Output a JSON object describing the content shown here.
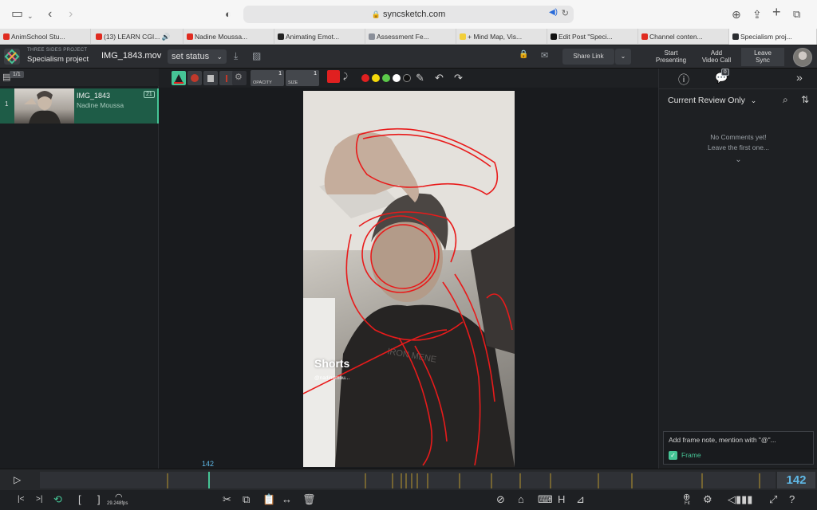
{
  "browser": {
    "url": "syncsketch.com",
    "tabs": [
      {
        "label": "AnimSchool Stu...",
        "favicon": "#e02b20"
      },
      {
        "label": "(13) LEARN CGI... 🔊",
        "favicon": "#e02b20"
      },
      {
        "label": "Nadine Moussa...",
        "favicon": "#e02b20"
      },
      {
        "label": "Animating Emot...",
        "favicon": "#222222"
      },
      {
        "label": "Assessment Fe...",
        "favicon": "#8a8f99"
      },
      {
        "label": "+ Mind Map, Vis...",
        "favicon": "#f2cf3a"
      },
      {
        "label": "Edit Post \"Speci...",
        "favicon": "#111111"
      },
      {
        "label": "Channel conten...",
        "favicon": "#e02b20"
      },
      {
        "label": "Specialism proj...",
        "favicon": "#2b2d31"
      }
    ]
  },
  "header": {
    "project_sub": "THREE SIDES PROJECT",
    "project_name": "Specialism project",
    "file_name": "IMG_1843.mov",
    "status_label": "set status",
    "share_link": "Share Link",
    "start_presenting": [
      "Start",
      "Presenting"
    ],
    "add_video_call": [
      "Add",
      "Video Call"
    ],
    "leave_sync": [
      "Leave",
      "Sync"
    ]
  },
  "left_panel": {
    "page_badge": "1/1",
    "asset": {
      "index": "1",
      "title": "IMG_1843",
      "author": "Nadine Moussa",
      "count": "21"
    }
  },
  "toolbar": {
    "opacity_label": "OPACITY",
    "opacity_value": "1",
    "size_label": "SIZE",
    "size_value": "1",
    "active_color": "#e02020",
    "palette": [
      "#e02020",
      "#f5d90a",
      "#5cc94a",
      "#ffffff",
      "#111111"
    ]
  },
  "viewer": {
    "shorts_label": "Shorts",
    "shorts_handle": "@nadinemou..."
  },
  "right_panel": {
    "comments_badge": "0",
    "filter_label": "Current Review Only",
    "no_comments_line1": "No Comments yet!",
    "no_comments_line2": "Leave the first one...",
    "note_placeholder": "Add frame note, mention with \"@\"...",
    "frame_label": "Frame"
  },
  "timeline": {
    "current_frame": "142",
    "fps": "29.248fps"
  },
  "bottom": {
    "fit_label": "Fit",
    "h_label": "H"
  }
}
